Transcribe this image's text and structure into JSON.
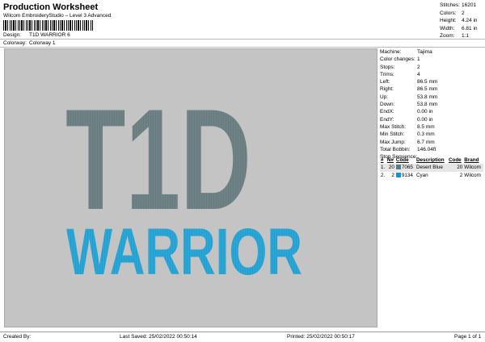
{
  "header": {
    "title": "Production Worksheet",
    "subtitle": "Wilcom EmbroideryStudio – Level 3 Advanced",
    "design_label": "Design:",
    "design_value": "T1D WARRIOR 6",
    "colorway_label": "Colorway:",
    "colorway_value": "Colorway 1"
  },
  "stats": [
    {
      "label": "Stitches:",
      "value": "16201"
    },
    {
      "label": "Colors:",
      "value": "2"
    },
    {
      "label": "Height:",
      "value": "4.24 in"
    },
    {
      "label": "Width:",
      "value": "6.81 in"
    },
    {
      "label": "Zoom:",
      "value": "1:1"
    }
  ],
  "design": {
    "line1": "T1D",
    "line2": "WARRIOR",
    "colors": {
      "background": "#c4c4c4",
      "grey_thread": "#6f8286",
      "cyan_thread": "#2aa7d6"
    }
  },
  "props": [
    {
      "label": "Machine:",
      "value": "Tajima"
    },
    {
      "label": "Color changes:",
      "value": "1"
    },
    {
      "label": "Stops:",
      "value": "2"
    },
    {
      "label": "Trims:",
      "value": "4"
    },
    {
      "label": "Left:",
      "value": "86.5 mm"
    },
    {
      "label": "Right:",
      "value": "86.5 mm"
    },
    {
      "label": "Up:",
      "value": "53.8 mm"
    },
    {
      "label": "Down:",
      "value": "53.8 mm"
    },
    {
      "label": "EndX:",
      "value": "0.00 in"
    },
    {
      "label": "EndY:",
      "value": "0.00 in"
    },
    {
      "label": "Max Stitch:",
      "value": "8.5 mm"
    },
    {
      "label": "Min Stitch:",
      "value": "0.3 mm"
    },
    {
      "label": "Max Jump:",
      "value": "6.7 mm"
    },
    {
      "label": "Total Bobbin:",
      "value": "146.04ft"
    }
  ],
  "stop_sequence": {
    "title": "Stop Sequence:",
    "headers": [
      "#",
      "N#",
      "Code",
      "Description",
      "Code",
      "Brand"
    ],
    "rows": [
      {
        "seq": "1.",
        "n": "20",
        "code": "7065",
        "desc": "Desert Blue",
        "code2": "20",
        "brand": "Wilcom",
        "color": "#5a7a88"
      },
      {
        "seq": "2.",
        "n": "2",
        "code": "9134",
        "desc": "Cyan",
        "code2": "2",
        "brand": "Wilcom",
        "color": "#1c8fd0"
      }
    ]
  },
  "footer": {
    "created": "Created By:",
    "saved": "Last Saved: 25/02/2022 00:50:14",
    "printed": "Printed: 25/02/2022 00:50:17",
    "page": "Page 1 of 1"
  }
}
